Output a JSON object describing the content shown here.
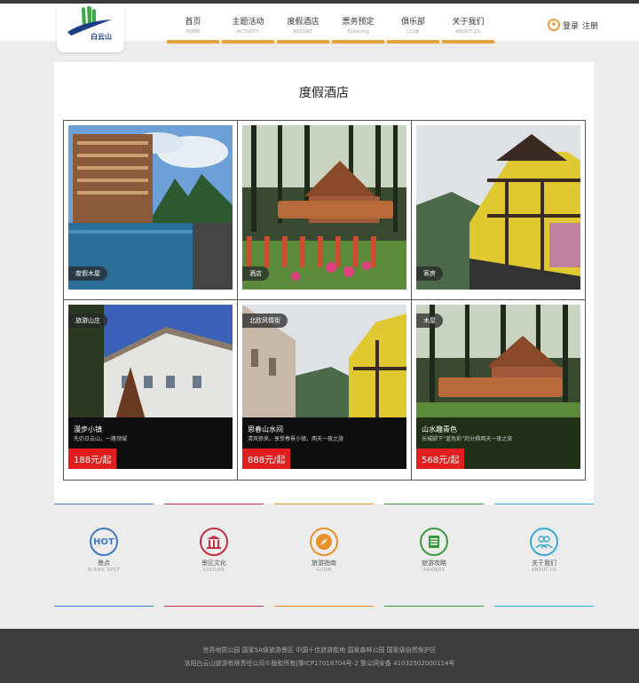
{
  "logo": {
    "text": "白云山"
  },
  "nav": [
    {
      "cn": "首页",
      "en": "HOME"
    },
    {
      "cn": "主题活动",
      "en": "ACTIVITY"
    },
    {
      "cn": "度假酒店",
      "en": "RESORT"
    },
    {
      "cn": "票务预定",
      "en": "Ticketing"
    },
    {
      "cn": "俱乐部",
      "en": "CLUB"
    },
    {
      "cn": "关于我们",
      "en": "ABOUT US"
    }
  ],
  "login": {
    "login_label": "登录",
    "register_label": "注册"
  },
  "section_title": "度假酒店",
  "hotels": [
    {
      "tag": "度假木屋"
    },
    {
      "tag": "酒店"
    },
    {
      "tag": "客房"
    },
    {
      "tag": "旅游山庄",
      "title": "漫步小镇",
      "desc": "先仍日云山，一路领城",
      "price": "188元/起"
    },
    {
      "tag": "北欧风情街",
      "title": "思春山水间",
      "desc": "清风徐来，享受春景小镇，两天一夜之旅",
      "price": "888元/起"
    },
    {
      "tag": "木屋",
      "title": "山水趣青色",
      "desc": "长城脚下“蓝色彩”的分俱两天一夜之旅",
      "price": "568元/起"
    }
  ],
  "features": [
    {
      "cn": "景点",
      "en": "SCENIC SPOT",
      "icon": "HOT",
      "color": "#3a78c8"
    },
    {
      "cn": "景区文化",
      "en": "CULTURE",
      "icon": "temple-icon",
      "color": "#c03040"
    },
    {
      "cn": "旅游指南",
      "en": "GUIDE",
      "icon": "compass-icon",
      "color": "#e8902a"
    },
    {
      "cn": "旅游攻略",
      "en": "RAIDERS",
      "icon": "document-icon",
      "color": "#3a9a40"
    },
    {
      "cn": "关于我们",
      "en": "ABOUT US",
      "icon": "people-icon",
      "color": "#38a8d8"
    }
  ],
  "footer": {
    "line1": "世界地质公园  国家5A级旅游景区  中国十佳旅游胜地  国家森林公园  国家级自然保护区",
    "line2": "洛阳白云山旅游有限责任公司©版权所有|豫ICP17018704号-2  豫公网安备 41032502000114号"
  }
}
